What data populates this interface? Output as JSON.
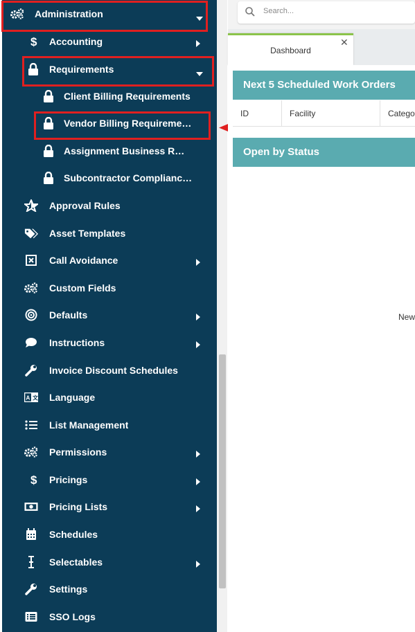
{
  "sidebar": {
    "admin_label": "Administration",
    "items": [
      {
        "label": "Accounting"
      },
      {
        "label": "Requirements"
      },
      {
        "label": "Client Billing Requirements"
      },
      {
        "label": "Vendor Billing Requirements"
      },
      {
        "label": "Assignment Business Requirements"
      },
      {
        "label": "Subcontractor Compliance Requirements"
      },
      {
        "label": "Approval Rules"
      },
      {
        "label": "Asset Templates"
      },
      {
        "label": "Call Avoidance"
      },
      {
        "label": "Custom Fields"
      },
      {
        "label": "Defaults"
      },
      {
        "label": "Instructions"
      },
      {
        "label": "Invoice Discount Schedules"
      },
      {
        "label": "Language"
      },
      {
        "label": "List Management"
      },
      {
        "label": "Permissions"
      },
      {
        "label": "Pricings"
      },
      {
        "label": "Pricing Lists"
      },
      {
        "label": "Schedules"
      },
      {
        "label": "Selectables"
      },
      {
        "label": "Settings"
      },
      {
        "label": "SSO Logs"
      }
    ]
  },
  "search": {
    "placeholder": "Search..."
  },
  "tabs": [
    {
      "label": "Dashboard"
    }
  ],
  "panels": {
    "work_orders_title": "Next 5 Scheduled Work Orders",
    "columns": [
      "ID",
      "Facility",
      "Category"
    ],
    "open_status_title": "Open by Status",
    "chart_text": "New"
  },
  "colors": {
    "sidebar": "#0c3c57",
    "panel": "#5aabb0",
    "highlight": "#e02020",
    "tab_accent": "#8bc34a"
  }
}
